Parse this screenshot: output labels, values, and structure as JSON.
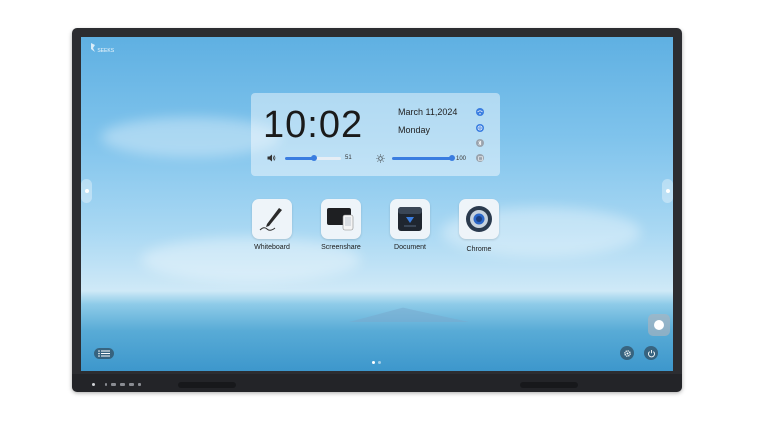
{
  "status_bar": {
    "logo_text": "SEEKS"
  },
  "widget": {
    "time": "10:02",
    "date": "March 11,2024",
    "weekday": "Monday",
    "volume": {
      "value": "51",
      "fraction": 0.51
    },
    "brightness": {
      "value": "100",
      "fraction": 1.0
    },
    "status_icons": [
      "wifi-icon",
      "hotspot-icon",
      "bluetooth-icon",
      "ethernet-icon"
    ]
  },
  "apps": [
    {
      "label": "Whiteboard",
      "icon": "pen-icon"
    },
    {
      "label": "Screenshare",
      "icon": "screenshare-icon"
    },
    {
      "label": "Document",
      "icon": "document-icon"
    },
    {
      "label": "Chrome",
      "icon": "chrome-icon"
    }
  ],
  "pagination": {
    "pages": 2,
    "current": 1
  },
  "colors": {
    "accent": "#3a7de0",
    "bezel": "#2c2d31"
  }
}
